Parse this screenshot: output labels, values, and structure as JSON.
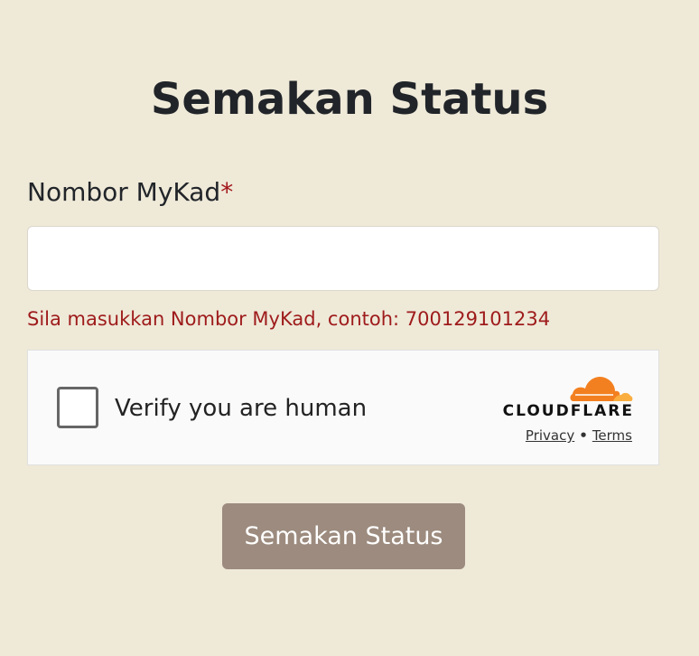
{
  "page": {
    "title": "Semakan Status"
  },
  "form": {
    "mykad_label": "Nombor MyKad",
    "required_marker": "*",
    "mykad_value": "",
    "mykad_placeholder": "",
    "error_message": "Sila masukkan Nombor MyKad, contoh: 700129101234",
    "submit_label": "Semakan Status"
  },
  "captcha": {
    "checkbox_label": "Verify you are human",
    "checked": false,
    "brand": "CLOUDFLARE",
    "privacy_link": "Privacy",
    "separator": "•",
    "terms_link": "Terms",
    "logo_icon": "cloudflare-cloud-icon"
  },
  "colors": {
    "background": "#efe9d8",
    "error": "#9e1b1b",
    "required": "#a3171b",
    "button": "#9c8b7e",
    "cloudflare_orange": "#f38020",
    "cloudflare_light_orange": "#faae40"
  }
}
